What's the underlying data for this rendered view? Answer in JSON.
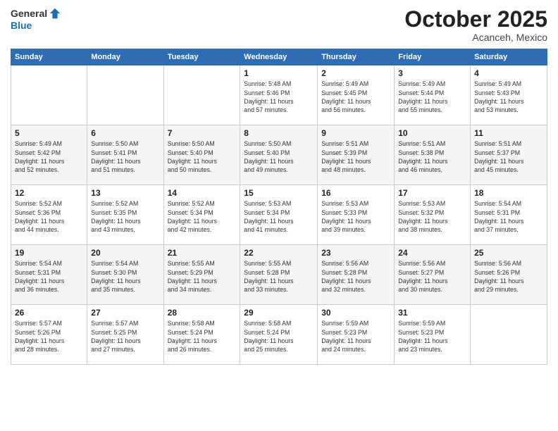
{
  "logo": {
    "general": "General",
    "blue": "Blue"
  },
  "header": {
    "month": "October 2025",
    "location": "Acanceh, Mexico"
  },
  "weekdays": [
    "Sunday",
    "Monday",
    "Tuesday",
    "Wednesday",
    "Thursday",
    "Friday",
    "Saturday"
  ],
  "weeks": [
    [
      {
        "day": "",
        "info": ""
      },
      {
        "day": "",
        "info": ""
      },
      {
        "day": "",
        "info": ""
      },
      {
        "day": "1",
        "info": "Sunrise: 5:48 AM\nSunset: 5:46 PM\nDaylight: 11 hours\nand 57 minutes."
      },
      {
        "day": "2",
        "info": "Sunrise: 5:49 AM\nSunset: 5:45 PM\nDaylight: 11 hours\nand 56 minutes."
      },
      {
        "day": "3",
        "info": "Sunrise: 5:49 AM\nSunset: 5:44 PM\nDaylight: 11 hours\nand 55 minutes."
      },
      {
        "day": "4",
        "info": "Sunrise: 5:49 AM\nSunset: 5:43 PM\nDaylight: 11 hours\nand 53 minutes."
      }
    ],
    [
      {
        "day": "5",
        "info": "Sunrise: 5:49 AM\nSunset: 5:42 PM\nDaylight: 11 hours\nand 52 minutes."
      },
      {
        "day": "6",
        "info": "Sunrise: 5:50 AM\nSunset: 5:41 PM\nDaylight: 11 hours\nand 51 minutes."
      },
      {
        "day": "7",
        "info": "Sunrise: 5:50 AM\nSunset: 5:40 PM\nDaylight: 11 hours\nand 50 minutes."
      },
      {
        "day": "8",
        "info": "Sunrise: 5:50 AM\nSunset: 5:40 PM\nDaylight: 11 hours\nand 49 minutes."
      },
      {
        "day": "9",
        "info": "Sunrise: 5:51 AM\nSunset: 5:39 PM\nDaylight: 11 hours\nand 48 minutes."
      },
      {
        "day": "10",
        "info": "Sunrise: 5:51 AM\nSunset: 5:38 PM\nDaylight: 11 hours\nand 46 minutes."
      },
      {
        "day": "11",
        "info": "Sunrise: 5:51 AM\nSunset: 5:37 PM\nDaylight: 11 hours\nand 45 minutes."
      }
    ],
    [
      {
        "day": "12",
        "info": "Sunrise: 5:52 AM\nSunset: 5:36 PM\nDaylight: 11 hours\nand 44 minutes."
      },
      {
        "day": "13",
        "info": "Sunrise: 5:52 AM\nSunset: 5:35 PM\nDaylight: 11 hours\nand 43 minutes."
      },
      {
        "day": "14",
        "info": "Sunrise: 5:52 AM\nSunset: 5:34 PM\nDaylight: 11 hours\nand 42 minutes."
      },
      {
        "day": "15",
        "info": "Sunrise: 5:53 AM\nSunset: 5:34 PM\nDaylight: 11 hours\nand 41 minutes."
      },
      {
        "day": "16",
        "info": "Sunrise: 5:53 AM\nSunset: 5:33 PM\nDaylight: 11 hours\nand 39 minutes."
      },
      {
        "day": "17",
        "info": "Sunrise: 5:53 AM\nSunset: 5:32 PM\nDaylight: 11 hours\nand 38 minutes."
      },
      {
        "day": "18",
        "info": "Sunrise: 5:54 AM\nSunset: 5:31 PM\nDaylight: 11 hours\nand 37 minutes."
      }
    ],
    [
      {
        "day": "19",
        "info": "Sunrise: 5:54 AM\nSunset: 5:31 PM\nDaylight: 11 hours\nand 36 minutes."
      },
      {
        "day": "20",
        "info": "Sunrise: 5:54 AM\nSunset: 5:30 PM\nDaylight: 11 hours\nand 35 minutes."
      },
      {
        "day": "21",
        "info": "Sunrise: 5:55 AM\nSunset: 5:29 PM\nDaylight: 11 hours\nand 34 minutes."
      },
      {
        "day": "22",
        "info": "Sunrise: 5:55 AM\nSunset: 5:28 PM\nDaylight: 11 hours\nand 33 minutes."
      },
      {
        "day": "23",
        "info": "Sunrise: 5:56 AM\nSunset: 5:28 PM\nDaylight: 11 hours\nand 32 minutes."
      },
      {
        "day": "24",
        "info": "Sunrise: 5:56 AM\nSunset: 5:27 PM\nDaylight: 11 hours\nand 30 minutes."
      },
      {
        "day": "25",
        "info": "Sunrise: 5:56 AM\nSunset: 5:26 PM\nDaylight: 11 hours\nand 29 minutes."
      }
    ],
    [
      {
        "day": "26",
        "info": "Sunrise: 5:57 AM\nSunset: 5:26 PM\nDaylight: 11 hours\nand 28 minutes."
      },
      {
        "day": "27",
        "info": "Sunrise: 5:57 AM\nSunset: 5:25 PM\nDaylight: 11 hours\nand 27 minutes."
      },
      {
        "day": "28",
        "info": "Sunrise: 5:58 AM\nSunset: 5:24 PM\nDaylight: 11 hours\nand 26 minutes."
      },
      {
        "day": "29",
        "info": "Sunrise: 5:58 AM\nSunset: 5:24 PM\nDaylight: 11 hours\nand 25 minutes."
      },
      {
        "day": "30",
        "info": "Sunrise: 5:59 AM\nSunset: 5:23 PM\nDaylight: 11 hours\nand 24 minutes."
      },
      {
        "day": "31",
        "info": "Sunrise: 5:59 AM\nSunset: 5:23 PM\nDaylight: 11 hours\nand 23 minutes."
      },
      {
        "day": "",
        "info": ""
      }
    ]
  ]
}
